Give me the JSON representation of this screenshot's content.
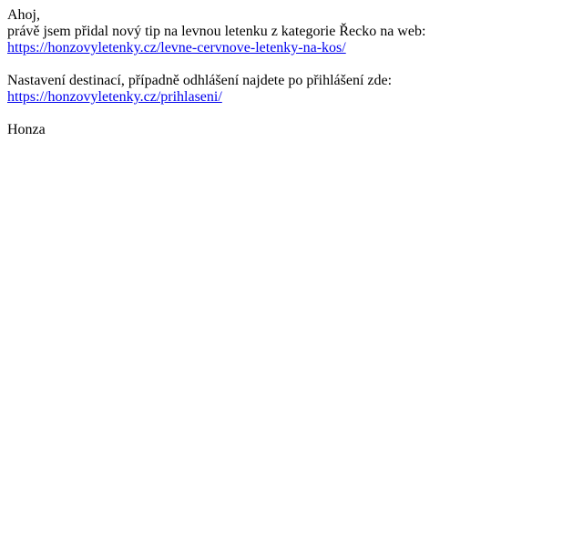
{
  "email": {
    "greeting": "Ahoj,",
    "intro": "právě jsem přidal nový tip na levnou letenku z kategorie Řecko na web:",
    "tip_link": "https://honzovyletenky.cz/levne-cervnove-letenky-na-kos/",
    "settings_text": "Nastavení destinací, případně odhlášení najdete po přihlášení zde:",
    "login_link": "https://honzovyletenky.cz/prihlaseni/",
    "signature": "Honza"
  },
  "colors": {
    "link": "#0000ee",
    "text": "#000000",
    "background": "#ffffff"
  }
}
